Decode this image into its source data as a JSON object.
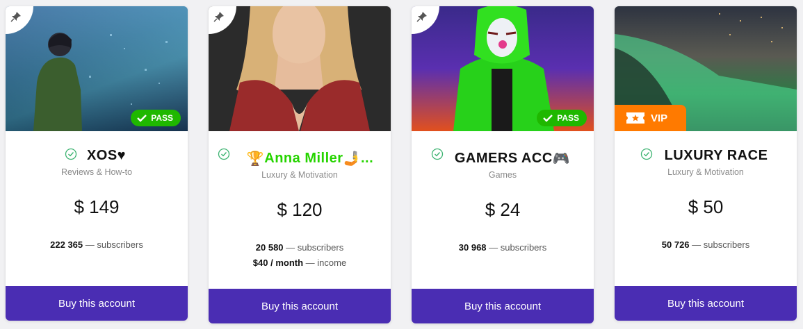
{
  "cards": [
    {
      "title": "XOS♥",
      "category": "Reviews & How-to",
      "price": "$ 149",
      "subscribers_value": "222 365",
      "subscribers_label": "— subscribers",
      "badge": "PASS",
      "button": "Buy this account"
    },
    {
      "title_emoji_left": "🏆",
      "title": "Anna Miller",
      "title_emoji_right": "🤳",
      "title_ellipsis": "...",
      "category": "Luxury & Motivation",
      "price": "$ 120",
      "subscribers_value": "20 580",
      "subscribers_label": "— subscribers",
      "income_value": "$40 / month",
      "income_label": "— income",
      "button": "Buy this account"
    },
    {
      "title": "GAMERS ACC",
      "title_emoji_right": "🎮",
      "category": "Games",
      "price": "$ 24",
      "subscribers_value": "30 968",
      "subscribers_label": "— subscribers",
      "badge": "PASS",
      "button": "Buy this account"
    },
    {
      "title": "LUXURY RACE",
      "category": "Luxury & Motivation",
      "price": "$ 50",
      "subscribers_value": "50 726",
      "subscribers_label": "— subscribers",
      "badge": "VIP",
      "button": "Buy this account"
    }
  ],
  "colors": {
    "button": "#4a2db3",
    "pass_badge": "#1fb800",
    "vip_badge": "#ff7a00",
    "verified": "#3cb371"
  }
}
